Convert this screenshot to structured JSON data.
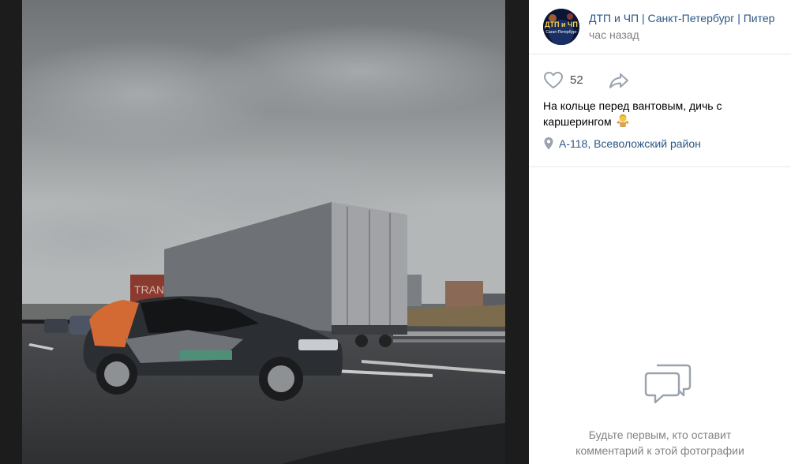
{
  "post": {
    "author_name": "ДТП и ЧП | Санкт-Петербург | Питер",
    "time": "час назад",
    "likes": "52",
    "caption": "На кольце перед вантовым, дичь с каршерингом",
    "location": "А-118, Всеволожский район",
    "avatar_text": "ДТП и ЧП",
    "avatar_subtext": "Санкт-Петербург"
  },
  "comments": {
    "empty_line1": "Будьте первым, кто оставит",
    "empty_line2": "комментарий к этой фотографии"
  },
  "photo": {
    "truck_text": "TRAN"
  },
  "icons": {
    "like": "heart-icon",
    "share": "share-arrow-icon",
    "location": "location-pin-icon",
    "empty_comments": "speech-bubbles-icon",
    "emoji": "woman-shrugging-emoji"
  },
  "colors": {
    "link": "#2a5885",
    "muted": "#828282",
    "icon": "#99a2ad"
  }
}
